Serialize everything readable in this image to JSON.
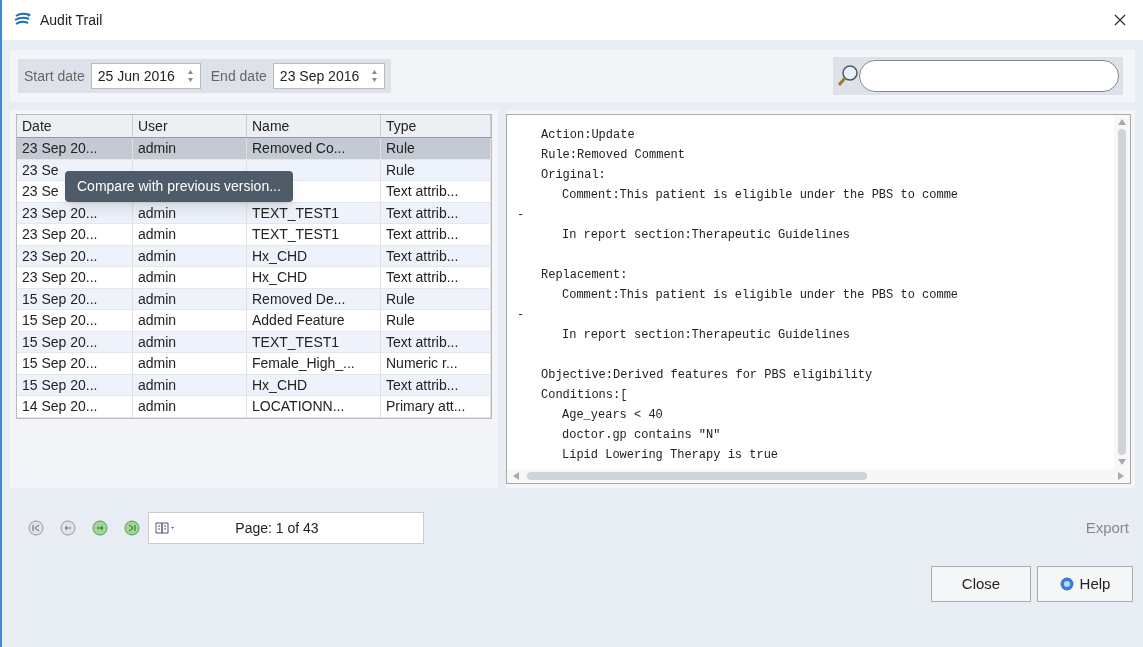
{
  "window": {
    "title": "Audit Trail"
  },
  "filters": {
    "start_label": "Start date",
    "start_value": "25 Jun 2016",
    "end_label": "End date",
    "end_value": "23 Sep 2016"
  },
  "table": {
    "columns": [
      "Date",
      "User",
      "Name",
      "Type"
    ],
    "rows": [
      {
        "cells": [
          "23 Sep 20...",
          "admin",
          "Removed Co...",
          "Rule"
        ],
        "selected": true
      },
      {
        "cells": [
          "23 Se",
          "",
          "",
          "Rule"
        ],
        "selected": false
      },
      {
        "cells": [
          "23 Se",
          "",
          "",
          "Text attrib..."
        ],
        "selected": false
      },
      {
        "cells": [
          "23 Sep 20...",
          "admin",
          "TEXT_TEST1",
          "Text attrib..."
        ],
        "selected": false
      },
      {
        "cells": [
          "23 Sep 20...",
          "admin",
          "TEXT_TEST1",
          "Text attrib..."
        ],
        "selected": false
      },
      {
        "cells": [
          "23 Sep 20...",
          "admin",
          "Hx_CHD",
          "Text attrib..."
        ],
        "selected": false
      },
      {
        "cells": [
          "23 Sep 20...",
          "admin",
          "Hx_CHD",
          "Text attrib..."
        ],
        "selected": false
      },
      {
        "cells": [
          "15 Sep 20...",
          "admin",
          "Removed De...",
          "Rule"
        ],
        "selected": false
      },
      {
        "cells": [
          "15 Sep 20...",
          "admin",
          "Added Feature",
          "Rule"
        ],
        "selected": false
      },
      {
        "cells": [
          "15 Sep 20...",
          "admin",
          "TEXT_TEST1",
          "Text attrib..."
        ],
        "selected": false
      },
      {
        "cells": [
          "15 Sep 20...",
          "admin",
          "Female_High_...",
          "Numeric r..."
        ],
        "selected": false
      },
      {
        "cells": [
          "15 Sep 20...",
          "admin",
          "Hx_CHD",
          "Text attrib..."
        ],
        "selected": false
      },
      {
        "cells": [
          "14 Sep 20...",
          "admin",
          "LOCATIONN...",
          "Primary att..."
        ],
        "selected": false
      }
    ]
  },
  "tooltip": {
    "text": "Compare with previous version..."
  },
  "detail": {
    "lines": [
      {
        "kind": "text",
        "text": "Action:Update"
      },
      {
        "kind": "text",
        "text": "Rule:Removed Comment"
      },
      {
        "kind": "text",
        "text": "Original:"
      },
      {
        "kind": "indented",
        "text": "Comment:This patient is eligible under the PBS to comme"
      },
      {
        "kind": "dash",
        "text": "-"
      },
      {
        "kind": "indented",
        "text": "In report section:Therapeutic Guidelines"
      },
      {
        "kind": "blank"
      },
      {
        "kind": "text",
        "text": "Replacement:"
      },
      {
        "kind": "indented",
        "text": "Comment:This patient is eligible under the PBS to comme"
      },
      {
        "kind": "dash",
        "text": "-"
      },
      {
        "kind": "indented",
        "text": "In report section:Therapeutic Guidelines"
      },
      {
        "kind": "blank"
      },
      {
        "kind": "text",
        "text": "Objective:Derived features for PBS eligibility"
      },
      {
        "kind": "text",
        "text": "Conditions:["
      },
      {
        "kind": "indented",
        "text": "Age_years < 40"
      },
      {
        "kind": "indented",
        "text": "doctor.gp contains \"N\""
      },
      {
        "kind": "indented",
        "text": "Lipid Lowering Therapy is true"
      }
    ]
  },
  "pager": {
    "text": "Page: 1 of 43",
    "export": "Export"
  },
  "buttons": [
    "Close",
    "Help"
  ]
}
